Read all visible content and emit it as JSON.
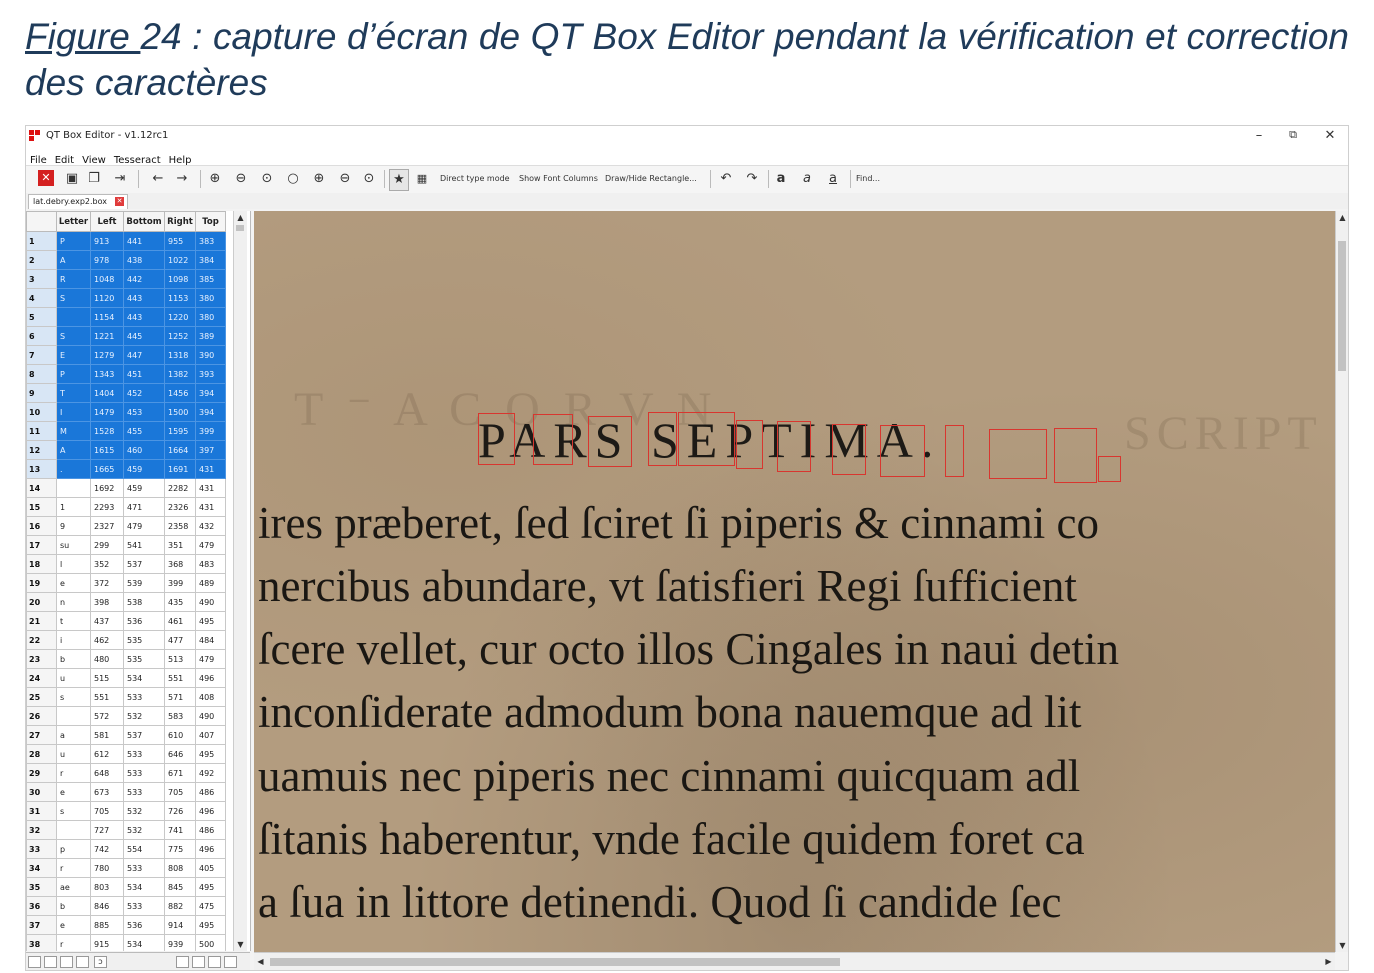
{
  "caption": {
    "figure_label": "Figure ",
    "text": "24 : capture d’écran de QT Box Editor pendant la vérification et correction des caractères"
  },
  "window": {
    "title": "QT Box Editor - v1.12rc1",
    "controls": {
      "minimize": "–",
      "maximize": "⧉",
      "close": "✕"
    }
  },
  "menu": [
    "File",
    "Edit",
    "View",
    "Tesseract",
    "Help"
  ],
  "toolbar": {
    "direct_type_mode": "Direct type mode",
    "show_font_columns": "Show Font Columns",
    "draw_hide_rectangles": "Draw/Hide Rectangle...",
    "bold": "a",
    "italic": "a",
    "underline": "a",
    "find": "Find..."
  },
  "tab": {
    "filename": "lat.debry.exp2.box"
  },
  "table": {
    "headers": [
      "Letter",
      "Left",
      "Bottom",
      "Right",
      "Top"
    ],
    "rows": [
      {
        "n": "1",
        "letter": "P",
        "left": "913",
        "bottom": "441",
        "right": "955",
        "top": "383",
        "selected": true
      },
      {
        "n": "2",
        "letter": "A",
        "left": "978",
        "bottom": "438",
        "right": "1022",
        "top": "384",
        "selected": true
      },
      {
        "n": "3",
        "letter": "R",
        "left": "1048",
        "bottom": "442",
        "right": "1098",
        "top": "385",
        "selected": true
      },
      {
        "n": "4",
        "letter": "S",
        "left": "1120",
        "bottom": "443",
        "right": "1153",
        "top": "380",
        "selected": true
      },
      {
        "n": "5",
        "letter": "",
        "left": "1154",
        "bottom": "443",
        "right": "1220",
        "top": "380",
        "selected": true
      },
      {
        "n": "6",
        "letter": "S",
        "left": "1221",
        "bottom": "445",
        "right": "1252",
        "top": "389",
        "selected": true
      },
      {
        "n": "7",
        "letter": "E",
        "left": "1279",
        "bottom": "447",
        "right": "1318",
        "top": "390",
        "selected": true
      },
      {
        "n": "8",
        "letter": "P",
        "left": "1343",
        "bottom": "451",
        "right": "1382",
        "top": "393",
        "selected": true
      },
      {
        "n": "9",
        "letter": "T",
        "left": "1404",
        "bottom": "452",
        "right": "1456",
        "top": "394",
        "selected": true
      },
      {
        "n": "10",
        "letter": "I",
        "left": "1479",
        "bottom": "453",
        "right": "1500",
        "top": "394",
        "selected": true
      },
      {
        "n": "11",
        "letter": "M",
        "left": "1528",
        "bottom": "455",
        "right": "1595",
        "top": "399",
        "selected": true
      },
      {
        "n": "12",
        "letter": "A",
        "left": "1615",
        "bottom": "460",
        "right": "1664",
        "top": "397",
        "selected": true
      },
      {
        "n": "13",
        "letter": ".",
        "left": "1665",
        "bottom": "459",
        "right": "1691",
        "top": "431",
        "selected": true
      },
      {
        "n": "14",
        "letter": "",
        "left": "1692",
        "bottom": "459",
        "right": "2282",
        "top": "431",
        "selected": false
      },
      {
        "n": "15",
        "letter": "1",
        "left": "2293",
        "bottom": "471",
        "right": "2326",
        "top": "431",
        "selected": false
      },
      {
        "n": "16",
        "letter": "9",
        "left": "2327",
        "bottom": "479",
        "right": "2358",
        "top": "432",
        "selected": false
      },
      {
        "n": "17",
        "letter": "su",
        "left": "299",
        "bottom": "541",
        "right": "351",
        "top": "479",
        "selected": false
      },
      {
        "n": "18",
        "letter": "l",
        "left": "352",
        "bottom": "537",
        "right": "368",
        "top": "483",
        "selected": false
      },
      {
        "n": "19",
        "letter": "e",
        "left": "372",
        "bottom": "539",
        "right": "399",
        "top": "489",
        "selected": false
      },
      {
        "n": "20",
        "letter": "n",
        "left": "398",
        "bottom": "538",
        "right": "435",
        "top": "490",
        "selected": false
      },
      {
        "n": "21",
        "letter": "t",
        "left": "437",
        "bottom": "536",
        "right": "461",
        "top": "495",
        "selected": false
      },
      {
        "n": "22",
        "letter": "i",
        "left": "462",
        "bottom": "535",
        "right": "477",
        "top": "484",
        "selected": false
      },
      {
        "n": "23",
        "letter": "b",
        "left": "480",
        "bottom": "535",
        "right": "513",
        "top": "479",
        "selected": false
      },
      {
        "n": "24",
        "letter": "u",
        "left": "515",
        "bottom": "534",
        "right": "551",
        "top": "496",
        "selected": false
      },
      {
        "n": "25",
        "letter": "s",
        "left": "551",
        "bottom": "533",
        "right": "571",
        "top": "408",
        "selected": false
      },
      {
        "n": "26",
        "letter": "",
        "left": "572",
        "bottom": "532",
        "right": "583",
        "top": "490",
        "selected": false
      },
      {
        "n": "27",
        "letter": "a",
        "left": "581",
        "bottom": "537",
        "right": "610",
        "top": "407",
        "selected": false
      },
      {
        "n": "28",
        "letter": "u",
        "left": "612",
        "bottom": "533",
        "right": "646",
        "top": "495",
        "selected": false
      },
      {
        "n": "29",
        "letter": "r",
        "left": "648",
        "bottom": "533",
        "right": "671",
        "top": "492",
        "selected": false
      },
      {
        "n": "30",
        "letter": "e",
        "left": "673",
        "bottom": "533",
        "right": "705",
        "top": "486",
        "selected": false
      },
      {
        "n": "31",
        "letter": "s",
        "left": "705",
        "bottom": "532",
        "right": "726",
        "top": "496",
        "selected": false
      },
      {
        "n": "32",
        "letter": "",
        "left": "727",
        "bottom": "532",
        "right": "741",
        "top": "486",
        "selected": false
      },
      {
        "n": "33",
        "letter": "p",
        "left": "742",
        "bottom": "554",
        "right": "775",
        "top": "496",
        "selected": false
      },
      {
        "n": "34",
        "letter": "r",
        "left": "780",
        "bottom": "533",
        "right": "808",
        "top": "405",
        "selected": false
      },
      {
        "n": "35",
        "letter": "ae",
        "left": "803",
        "bottom": "534",
        "right": "845",
        "top": "495",
        "selected": false
      },
      {
        "n": "36",
        "letter": "b",
        "left": "846",
        "bottom": "533",
        "right": "882",
        "top": "475",
        "selected": false
      },
      {
        "n": "37",
        "letter": "e",
        "left": "885",
        "bottom": "536",
        "right": "914",
        "top": "495",
        "selected": false
      },
      {
        "n": "38",
        "letter": "r",
        "left": "915",
        "bottom": "534",
        "right": "939",
        "top": "500",
        "selected": false
      }
    ]
  },
  "image": {
    "heading_text": "PARS SEPTIMA.",
    "lines": [
      "ires præberet, ſed ſciret ſi piperis & cinnami co",
      "nercibus abundare, vt ſatisfieri Regi ſufficient",
      "ſcere vellet, cur octo illos Cingales in naui detin",
      "inconſiderate admodum bona nauemque ad lit",
      "uamuis nec piperis nec cinnami quicquam adl",
      "ſitanis haberentur, vnde facile quidem foret ca",
      "a ſua in littore detinendi. Quod ſi candide ſec"
    ]
  },
  "colors": {
    "selection": "#1a77d9",
    "box_outline": "#d8362f",
    "caption": "#1f3b5a"
  }
}
